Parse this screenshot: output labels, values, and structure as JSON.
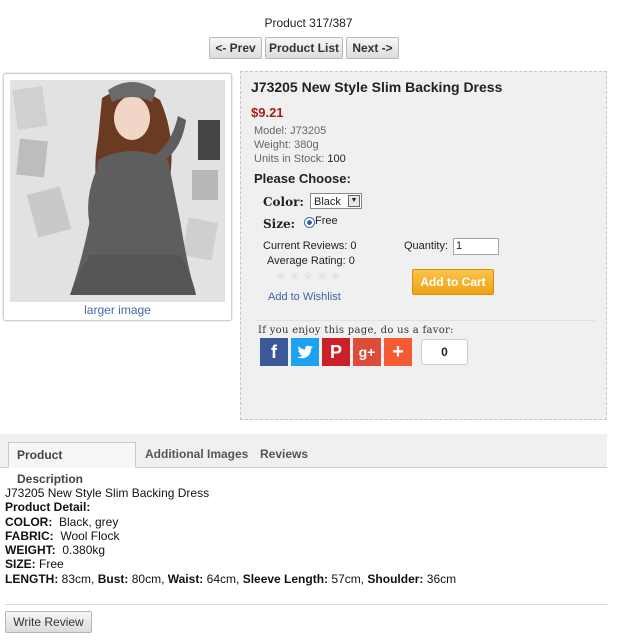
{
  "nav": {
    "counter": "Product 317/387",
    "prev": "<- Prev",
    "list": "Product List",
    "next": "Next ->"
  },
  "image": {
    "larger_link": "larger image"
  },
  "product": {
    "title": "J73205 New Style Slim Backing Dress",
    "price": "$9.21",
    "model_label": "Model:",
    "model_value": "J73205",
    "weight_label": "Weight:",
    "weight_value": "380g",
    "stock_label": "Units in Stock:",
    "stock_value": "100"
  },
  "options": {
    "heading": "Please Choose:",
    "color_label": "Color:",
    "color_selected": "Black",
    "size_label": "Size:",
    "size_option": "Free"
  },
  "reviews": {
    "current": "Current Reviews: 0",
    "average": "Average Rating: 0",
    "stars": "★★★★★"
  },
  "purchase": {
    "qty_label": "Quantity:",
    "qty_value": "1",
    "add_to_cart": "Add to Cart",
    "wishlist": "Add to Wishlist"
  },
  "share": {
    "favor_text": "If you enjoy this page, do us a favor:",
    "count": "0",
    "colors": {
      "facebook": "#3b5998",
      "twitter": "#1da1f2",
      "pinterest": "#cb2027",
      "googleplus": "#dd4b39",
      "more": "#f65a35"
    }
  },
  "tabs": [
    "Product Description",
    "Additional Images",
    "Reviews"
  ],
  "description": {
    "line1": "J73205 New Style Slim Backing Dress",
    "detail_heading": "Product Detail:",
    "color_label": "COLOR:",
    "color_value": "Black, grey",
    "fabric_label": "FABRIC:",
    "fabric_value": "Wool Flock",
    "weight_label": "WEIGHT:",
    "weight_value": "0.380kg",
    "size_label": "SIZE:",
    "size_value": "Free",
    "length_label": "LENGTH:",
    "length_value": "83cm,",
    "bust_label": "Bust:",
    "bust_value": "80cm,",
    "waist_label": "Waist:",
    "waist_value": "64cm,",
    "sleeve_label": "Sleeve Length:",
    "sleeve_value": "57cm,",
    "shoulder_label": "Shoulder:",
    "shoulder_value": "36cm"
  },
  "write_review": "Write Review"
}
